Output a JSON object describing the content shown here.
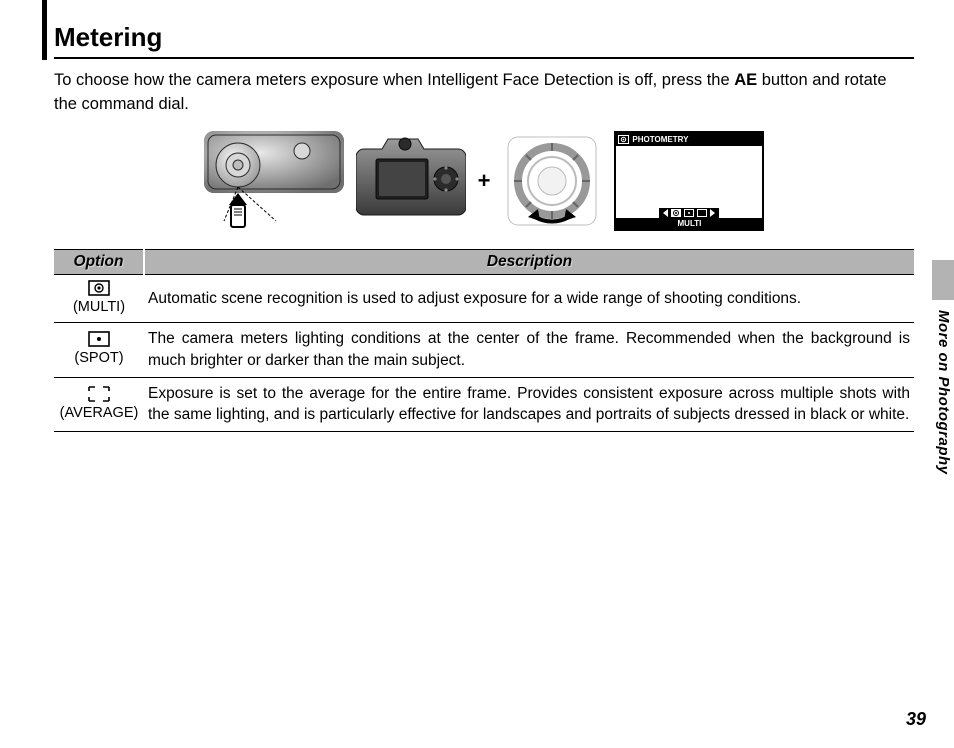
{
  "section_side": "More on Photography",
  "heading": "Metering",
  "intro_pre": "To choose how the camera meters exposure when Intelligent Face Detection is off, press the ",
  "intro_btn": "AE",
  "intro_post": " button and rotate the command dial.",
  "screen": {
    "title": "PHOTOMETRY",
    "footer": "MULTI"
  },
  "table": {
    "head_option": "Option",
    "head_desc": "Description",
    "rows": [
      {
        "icon": "multi",
        "label": "(MULTI)",
        "desc": "Automatic scene recognition is used to adjust exposure for a wide range of shooting conditions."
      },
      {
        "icon": "spot",
        "label": "(SPOT)",
        "desc": "The camera meters lighting conditions at the center of the frame.  Recommended when the background is much brighter or darker than the main subject."
      },
      {
        "icon": "average",
        "label": "(AVERAGE)",
        "desc": "Exposure is set to the average for the entire frame.  Provides consistent exposure across multiple shots with the same lighting, and is particularly effective for landscapes and portraits of subjects dressed in black or white."
      }
    ]
  },
  "page_number": "39",
  "plus": "+"
}
